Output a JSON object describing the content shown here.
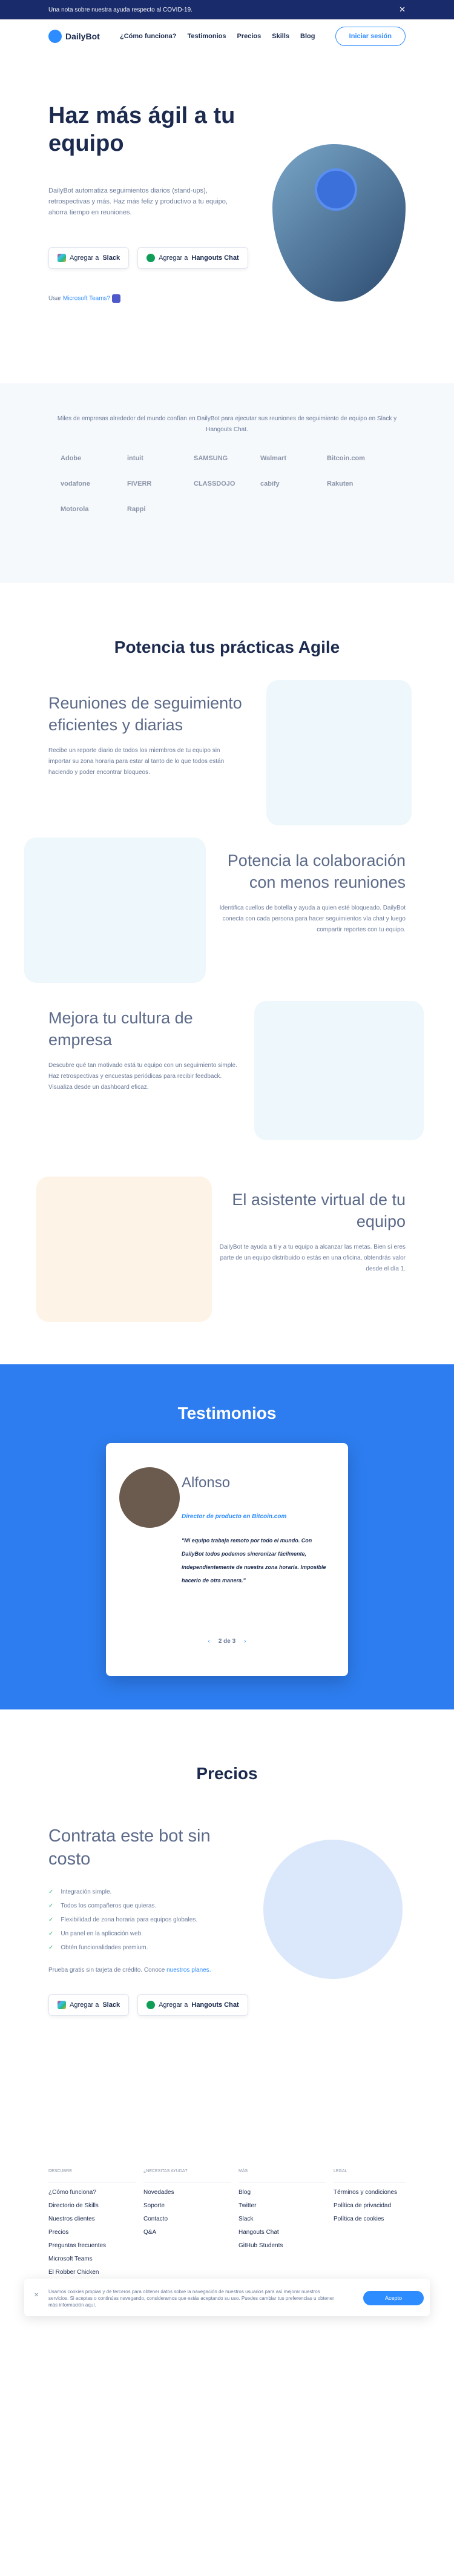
{
  "announcement": {
    "text": "Una nota sobre nuestra ayuda respecto al COVID-19."
  },
  "nav": {
    "logo": "DailyBot",
    "links": [
      "¿Cómo funciona?",
      "Testimonios",
      "Precios",
      "Skills",
      "Blog"
    ],
    "cta": "Iniciar sesión"
  },
  "hero": {
    "title": "Haz más ágil a tu equipo",
    "text": "DailyBot automatiza seguimientos diarios (stand-ups), retrospectivas y más. Haz más feliz y productivo a tu equipo, ahorra tiempo en reuniones.",
    "slack_pre": "Agregar a",
    "slack": "Slack",
    "hangouts_pre": "Agregar a",
    "hangouts": "Hangouts Chat",
    "ms_pre": "Usar",
    "ms_link": "Microsoft Teams?"
  },
  "clients": {
    "text": "Miles de empresas alrededor del mundo confían en DailyBot para ejecutar sus reuniones de seguimiento de equipo en Slack y Hangouts Chat.",
    "logos": [
      "Adobe",
      "intuit",
      "SAMSUNG",
      "Walmart",
      "Bitcoin.com",
      "vodafone",
      "FIVERR",
      "CLASSDOJO",
      "cabify",
      "Rakuten",
      "Motorola",
      "Rappi"
    ]
  },
  "agile": {
    "title": "Potencia tus prácticas Agile",
    "features": [
      {
        "title": "Reuniones de seguimiento eficientes y diarias",
        "text": "Recibe un reporte diario de todos los miembros de tu equipo sin importar su zona horaria para estar al tanto de lo que todos están haciendo y poder encontrar bloqueos."
      },
      {
        "title": "Potencia la colaboración con menos reuniones",
        "text": "Identifica cuellos de botella y ayuda a quien esté bloqueado. DailyBot conecta con cada persona para hacer seguimientos vía chat y luego compartir reportes con tu equipo."
      },
      {
        "title": "Mejora tu cultura de empresa",
        "text": "Descubre qué tan motivado está tu equipo con un seguimiento simple. Haz retrospectivas y encuestas periódicas para recibir feedback. Visualiza desde un dashboard eficaz."
      },
      {
        "title": "El asistente virtual de tu equipo",
        "text": "DailyBot te ayuda a ti y a tu equipo a alcanzar las metas. Bien sí eres parte de un equipo distribuido o estás en una oficina, obtendrás valor desde el día 1."
      }
    ]
  },
  "testimonials": {
    "title": "Testimonios",
    "name": "Alfonso",
    "role": "Director de producto en Bitcoin.com",
    "quote": "\"Mi equipo trabaja remoto por todo el mundo. Con DailyBot todos podemos sincronizar fácilmente, independientemente de nuestra zona horaria. Imposible hacerlo de otra manera.\"",
    "pager": "2 de 3"
  },
  "pricing": {
    "title": "Precios",
    "subtitle": "Contrata este bot sin costo",
    "items": [
      "Integración simple.",
      "Todos los compañeros que quieras.",
      "Flexibilidad de zona horaria para equipos globales.",
      "Un panel en la aplicación web.",
      "Obtén funcionalidades premium."
    ],
    "note": "Prueba gratis sin tarjeta de crédito. Conoce",
    "note_link": "nuestros planes."
  },
  "footer": {
    "cols": [
      {
        "h": "DESCUBRE",
        "items": [
          "¿Cómo funciona?",
          "Directorio de Skills",
          "Nuestros clientes",
          "Precios",
          "Preguntas frecuentes",
          "Microsoft Teams",
          "El Robber Chicken"
        ]
      },
      {
        "h": "¿NECESITAS AYUDA?",
        "items": [
          "Novedades",
          "Soporte",
          "Contacto",
          "Q&A"
        ]
      },
      {
        "h": "MÁS",
        "items": [
          "Blog",
          "Twitter",
          "Slack",
          "Hangouts Chat",
          "GitHub Students"
        ]
      },
      {
        "h": "LEGAL",
        "items": [
          "Términos y condiciones",
          "Política de privacidad",
          "Política de cookies"
        ]
      }
    ]
  },
  "cookie": {
    "text": "Usamos cookies propias y de terceros para obtener datos sobre la navegación de nuestros usuarios para así mejorar nuestros servicios. Si aceptas o continúas navegando, consideramos que estás aceptando su uso. Puedes cambiar tus preferencias u obtener más información aquí.",
    "accept": "Acepto"
  }
}
